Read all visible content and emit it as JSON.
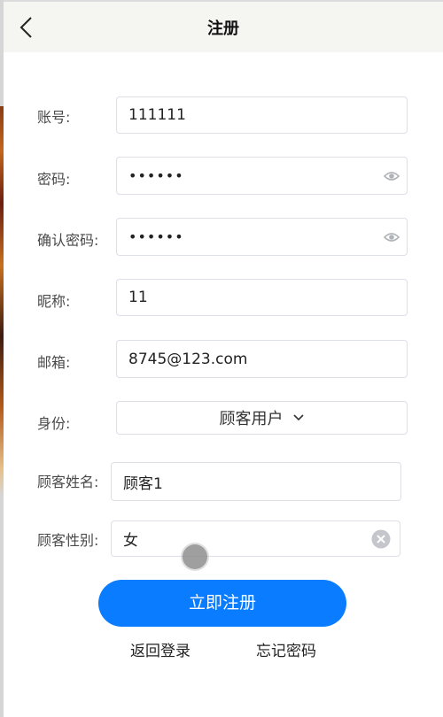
{
  "header": {
    "title": "注册",
    "back_icon": "chevron-left-icon"
  },
  "form": {
    "account": {
      "label": "账号:",
      "value": "111111"
    },
    "password": {
      "label": "密码:",
      "value": "••••••",
      "icon": "eye-icon"
    },
    "confirm_password": {
      "label": "确认密码:",
      "value": "••••••",
      "icon": "eye-icon"
    },
    "nickname": {
      "label": "昵称:",
      "value": "11"
    },
    "email": {
      "label": "邮箱:",
      "value": "8745@123.com"
    },
    "role": {
      "label": "身份:",
      "value": "顾客用户",
      "icon": "chevron-down-icon"
    },
    "customer_name": {
      "label": "顾客姓名:",
      "value": "顾客1"
    },
    "customer_gender": {
      "label": "顾客性别:",
      "value": "女",
      "icon": "clear-icon"
    }
  },
  "actions": {
    "submit_label": "立即注册",
    "back_to_login": "返回登录",
    "forgot_password": "忘记密码"
  },
  "colors": {
    "primary": "#0a7cff",
    "header_bg": "#f5f5f2",
    "border": "#dcdfe6"
  }
}
